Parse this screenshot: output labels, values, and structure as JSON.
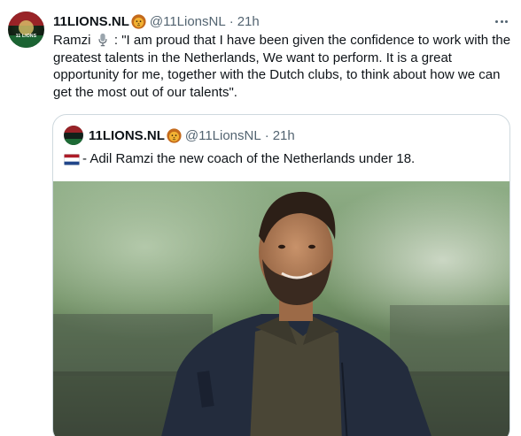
{
  "tweet": {
    "author_name": "11LIONS.NL",
    "author_handle": "@11LionsNL",
    "separator": "·",
    "time": "21h",
    "avatar_text": "11 LIONS",
    "text_prefix": "Ramzi",
    "text_body": ": \"I am proud that I have been given the confidence to work with the greatest talents in the Netherlands, We want to perform.  It is a great opportunity for me, together with the Dutch clubs, to think about how we can get the most out of our talents\".",
    "icons": {
      "more": "more-horizontal-icon",
      "lion": "lion-face-emoji",
      "mic": "microphone-emoji"
    }
  },
  "quoted": {
    "author_name": "11LIONS.NL",
    "author_handle": "@11LionsNL",
    "separator": "·",
    "time": "21h",
    "text": "- Adil Ramzi the new coach of the Netherlands under 18.",
    "flag": "netherlands-flag-emoji",
    "photo": "coach-portrait-photo"
  },
  "colors": {
    "text": "#0f1419",
    "secondary": "#536471",
    "border": "#cfd9de",
    "nl_red": "#ae1c28",
    "nl_blue": "#21468b"
  }
}
